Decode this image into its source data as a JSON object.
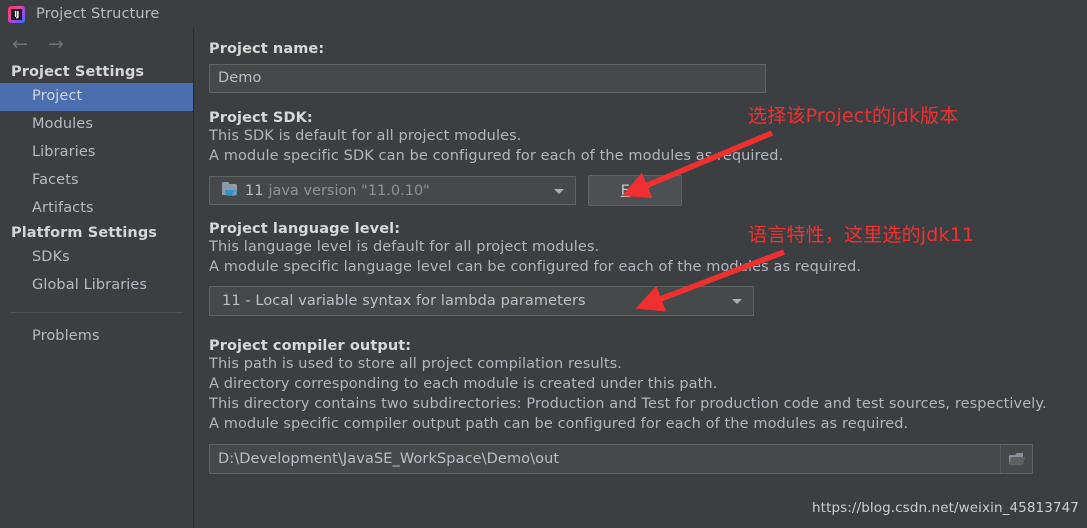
{
  "window": {
    "title": "Project Structure",
    "logo_text": "IJ"
  },
  "nav": {
    "back_icon": "←",
    "forward_icon": "→"
  },
  "sidebar": {
    "groups": [
      {
        "label": "Project Settings",
        "items": [
          {
            "label": "Project",
            "selected": true
          },
          {
            "label": "Modules",
            "selected": false
          },
          {
            "label": "Libraries",
            "selected": false
          },
          {
            "label": "Facets",
            "selected": false
          },
          {
            "label": "Artifacts",
            "selected": false
          }
        ]
      },
      {
        "label": "Platform Settings",
        "items": [
          {
            "label": "SDKs",
            "selected": false
          },
          {
            "label": "Global Libraries",
            "selected": false
          }
        ]
      }
    ],
    "problems_label": "Problems"
  },
  "main": {
    "project_name": {
      "label": "Project name:",
      "value": "Demo"
    },
    "project_sdk": {
      "label": "Project SDK:",
      "desc_line_1": "This SDK is default for all project modules.",
      "desc_line_2": "A module specific SDK can be configured for each of the modules as required.",
      "sdk_version": "11",
      "sdk_description": "java version \"11.0.10\"",
      "edit_button": "Edit",
      "edit_button_mnemonic": "E",
      "edit_button_rest": "dit"
    },
    "language_level": {
      "label": "Project language level:",
      "desc_line_1": "This language level is default for all project modules.",
      "desc_line_2": "A module specific language level can be configured for each of the modules as required.",
      "value": "11 - Local variable syntax for lambda parameters"
    },
    "compiler_output": {
      "label": "Project compiler output:",
      "desc_line_1": "This path is used to store all project compilation results.",
      "desc_line_2": "A directory corresponding to each module is created under this path.",
      "desc_line_3": "This directory contains two subdirectories: Production and Test for production code and test sources, respectively.",
      "desc_line_4": "A module specific compiler output path can be configured for each of the modules as required.",
      "value": "D:\\Development\\JavaSE_WorkSpace\\Demo\\out"
    }
  },
  "annotations": [
    {
      "text": "选择该Project的jdk版本"
    },
    {
      "text": "语言特性，这里选的jdk11"
    }
  ],
  "watermark": "https://blog.csdn.net/weixin_45813747",
  "colors": {
    "background": "#3c3f41",
    "selection": "#4b6eaf",
    "annotation_red": "#f03030",
    "field_bg": "#45494a"
  }
}
